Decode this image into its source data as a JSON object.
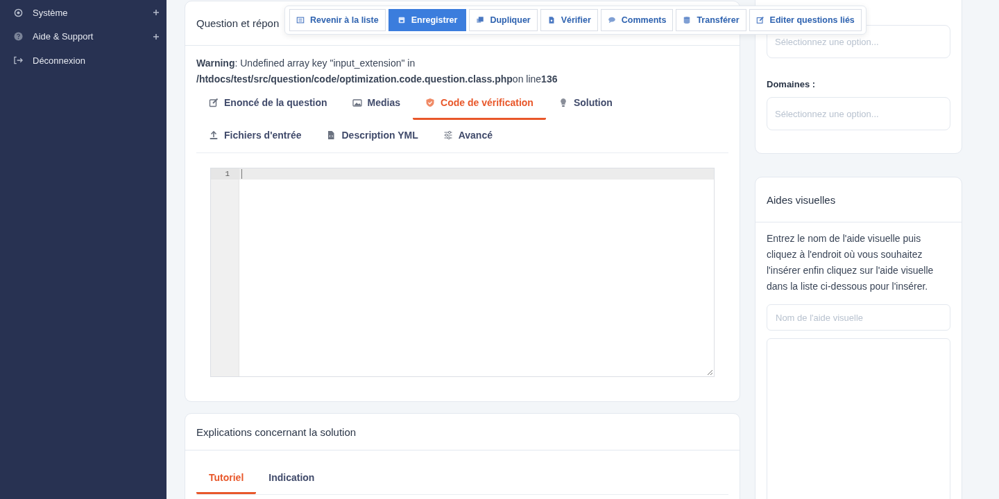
{
  "sidebar": {
    "items": [
      {
        "label": "Système",
        "expandable": true
      },
      {
        "label": "Aide & Support",
        "expandable": true
      },
      {
        "label": "Déconnexion",
        "expandable": false
      }
    ]
  },
  "toolbar": {
    "buttons": [
      {
        "label": "Revenir à la liste",
        "primary": false
      },
      {
        "label": "Enregistrer",
        "primary": true
      },
      {
        "label": "Dupliquer",
        "primary": false
      },
      {
        "label": "Vérifier",
        "primary": false
      },
      {
        "label": "Comments",
        "primary": false
      },
      {
        "label": "Transférer",
        "primary": false
      },
      {
        "label": "Editer questions liés",
        "primary": false
      }
    ]
  },
  "question_card": {
    "title": "Question et répon",
    "warning": "**Warning**: Undefined array key \"input_extension\" in **/htdocs/test/src/question/code/optimization.code.question.class.php**on line**136**",
    "tabs": [
      {
        "label": "Enoncé de la question",
        "selected": false
      },
      {
        "label": "Medias",
        "selected": false
      },
      {
        "label": "Code de vérification",
        "selected": true
      },
      {
        "label": "Solution",
        "selected": false
      },
      {
        "label": "Fichiers d'entrée",
        "selected": false
      },
      {
        "label": "Description YML",
        "selected": false
      },
      {
        "label": "Avancé",
        "selected": false
      }
    ],
    "editor": {
      "line_numbers": [
        "1"
      ]
    }
  },
  "explanations_card": {
    "title": "Explications concernant la solution",
    "tabs": [
      {
        "label": "Tutoriel",
        "selected": true
      },
      {
        "label": "Indication",
        "selected": false
      }
    ]
  },
  "filters_card": {
    "fields": [
      {
        "placeholder": "Sélectionnez une option..."
      },
      {
        "label": "Domaines :",
        "placeholder": "Sélectionnez une option..."
      }
    ]
  },
  "visual_aids_card": {
    "title": "Aides visuelles",
    "help": "Entrez le nom de l'aide visuelle puis cliquez à l'endroit où vous souhaitez l'insérer enfin cliquez sur l'aide visuelle dans la liste ci-dessous pour l'insérer.",
    "name_field": {
      "placeholder": "Nom de l'aide visuelle"
    }
  }
}
